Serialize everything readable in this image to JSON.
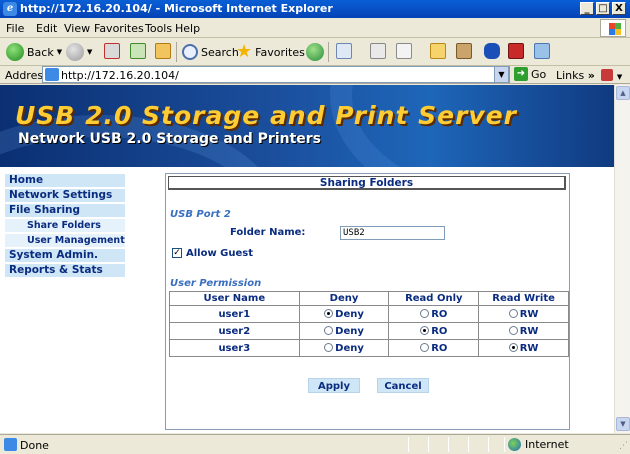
{
  "window": {
    "title": "http://172.16.20.104/ - Microsoft Internet Explorer",
    "controls": [
      "_",
      "□",
      "X"
    ]
  },
  "menu": [
    "File",
    "Edit",
    "View",
    "Favorites",
    "Tools",
    "Help"
  ],
  "toolbar": {
    "back": "Back",
    "search": "Search",
    "favorites": "Favorites"
  },
  "address": {
    "label": "Address",
    "url": "http://172.16.20.104/",
    "go": "Go",
    "links": "Links"
  },
  "banner": {
    "title": "USB 2.0 Storage and Print Server",
    "subtitle": "Network USB 2.0 Storage and Printers"
  },
  "nav": {
    "home": "Home",
    "network_settings": "Network Settings",
    "file_sharing": "File Sharing",
    "share_folders": "Share Folders",
    "user_management": "User Management",
    "system_admin": "System Admin.",
    "reports_stats": "Reports & Stats"
  },
  "panel": {
    "title": "Sharing Folders",
    "port": "USB Port 2",
    "folder_label": "Folder Name:",
    "folder_value": "USB2",
    "allow_guest": "Allow Guest",
    "allow_guest_checked": true,
    "user_permission": "User Permission",
    "headers": [
      "User Name",
      "Deny",
      "Read Only",
      "Read Write"
    ],
    "options": {
      "deny": "Deny",
      "ro": "RO",
      "rw": "RW"
    },
    "users": [
      {
        "name": "user1",
        "selected": "deny"
      },
      {
        "name": "user2",
        "selected": "ro"
      },
      {
        "name": "user3",
        "selected": "rw"
      }
    ],
    "apply": "Apply",
    "cancel": "Cancel"
  },
  "status": {
    "text": "Done",
    "zone": "Internet"
  }
}
